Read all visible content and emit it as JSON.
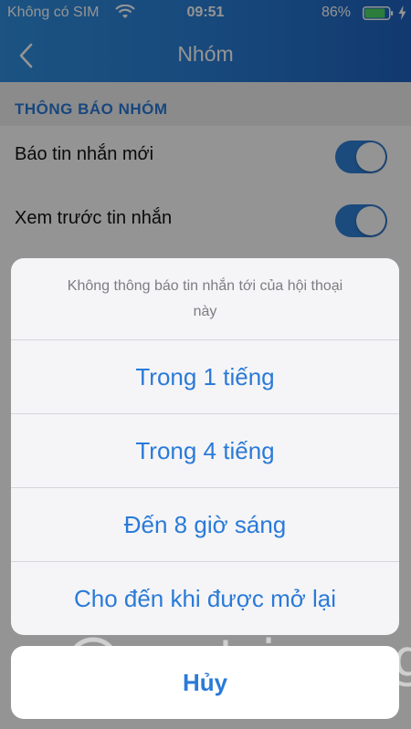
{
  "status_bar": {
    "carrier": "Không có SIM",
    "time": "09:51",
    "battery_percent": "86%",
    "battery_level": 0.86,
    "battery_color": "#4cd964"
  },
  "nav": {
    "title": "Nhóm",
    "back_icon": "chevron-left-icon"
  },
  "settings": {
    "section_title": "THÔNG BÁO NHÓM",
    "rows": [
      {
        "label": "Báo tin nhắn mới",
        "enabled": true
      },
      {
        "label": "Xem trước tin nhắn",
        "enabled": true
      }
    ]
  },
  "action_sheet": {
    "message": "Không thông báo tin nhắn tới của hội thoại này",
    "actions": [
      {
        "label": "Trong 1 tiếng"
      },
      {
        "label": "Trong 4 tiếng"
      },
      {
        "label": "Đến 8 giờ sáng"
      },
      {
        "label": "Cho đến khi được mở lại"
      }
    ],
    "cancel_label": "Hủy"
  },
  "watermark": {
    "text": "uantrimang"
  },
  "colors": {
    "accent": "#2a7ad8",
    "header_start": "#2f8fe0",
    "header_end": "#1f63c0"
  }
}
